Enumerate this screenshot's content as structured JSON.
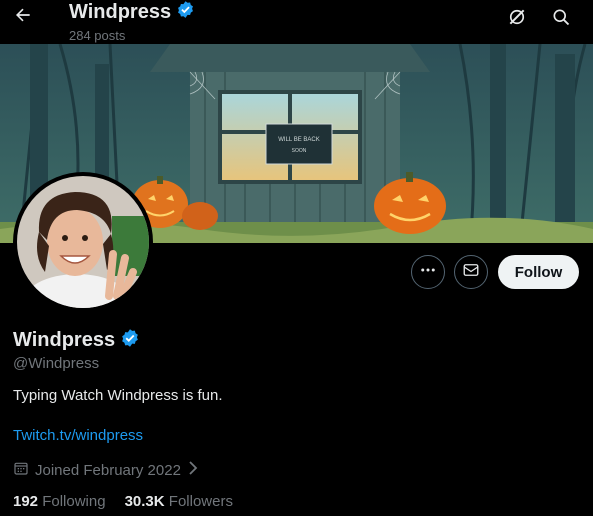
{
  "header": {
    "title": "Windpress",
    "post_count": "284 posts",
    "back_icon": "arrow-left-icon",
    "grok_icon": "grok-icon",
    "search_icon": "search-icon"
  },
  "profile": {
    "display_name": "Windpress",
    "handle": "@Windpress",
    "verified_color": "#1d9bf0",
    "bio": "Typing Watch Windpress is fun.",
    "website": "Twitch.tv/windpress",
    "joined": "Joined February 2022",
    "following_count": "192",
    "following_label": "Following",
    "followers_count": "30.3K",
    "followers_label": "Followers"
  },
  "banner": {
    "sign_line1": "WILL BE BACK",
    "sign_line2": "SOON"
  },
  "actions": {
    "more_icon": "more-icon",
    "message_icon": "envelope-icon",
    "follow_label": "Follow"
  },
  "colors": {
    "accent": "#1d9bf0",
    "background": "#000000",
    "secondary_text": "#71767b"
  }
}
